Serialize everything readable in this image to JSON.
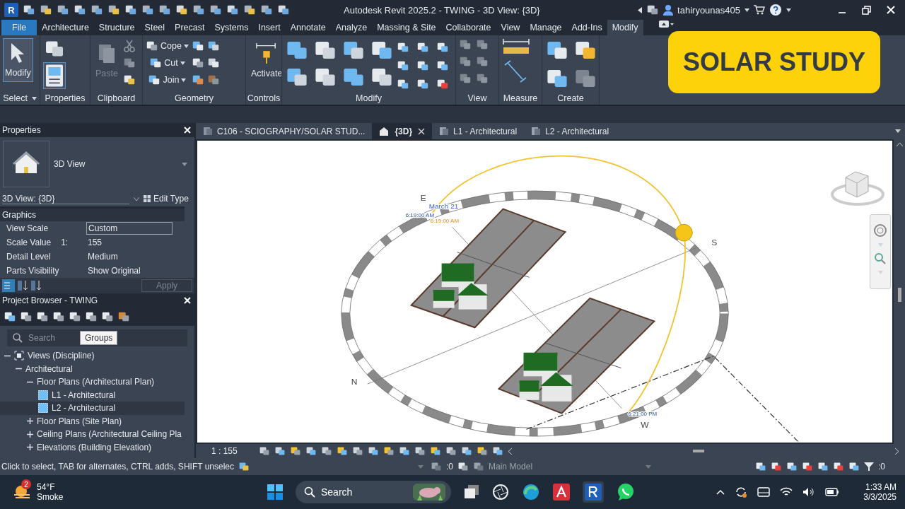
{
  "title_bar": {
    "logo": "R",
    "title": "Autodesk Revit 2025.2 - TWING - 3D View: {3D}",
    "user": "tahiryounas405"
  },
  "ribbon_tabs": [
    {
      "label": "File",
      "kind": "file",
      "selected": false
    },
    {
      "label": "Architecture",
      "kind": "tab",
      "selected": false
    },
    {
      "label": "Structure",
      "kind": "tab",
      "selected": false
    },
    {
      "label": "Steel",
      "kind": "tab",
      "selected": false
    },
    {
      "label": "Precast",
      "kind": "tab",
      "selected": false
    },
    {
      "label": "Systems",
      "kind": "tab",
      "selected": false
    },
    {
      "label": "Insert",
      "kind": "tab",
      "selected": false
    },
    {
      "label": "Annotate",
      "kind": "tab",
      "selected": false
    },
    {
      "label": "Analyze",
      "kind": "tab",
      "selected": false
    },
    {
      "label": "Massing & Site",
      "kind": "tab",
      "selected": false
    },
    {
      "label": "Collaborate",
      "kind": "tab",
      "selected": false
    },
    {
      "label": "View",
      "kind": "tab",
      "selected": false
    },
    {
      "label": "Manage",
      "kind": "tab",
      "selected": false
    },
    {
      "label": "Add-Ins",
      "kind": "tab",
      "selected": false
    },
    {
      "label": "Modify",
      "kind": "tab",
      "selected": true
    }
  ],
  "ribbon_panels": [
    {
      "title": "Select",
      "kind": "select",
      "tools": [
        {
          "label": "Modify",
          "selected": true
        }
      ]
    },
    {
      "title": "Properties",
      "kind": "properties"
    },
    {
      "title": "Clipboard",
      "kind": "clipboard",
      "tools": [
        {
          "label": "Paste",
          "disabled": true
        }
      ]
    },
    {
      "title": "Geometry",
      "kind": "geometry",
      "tools": [
        {
          "label": "Cope"
        },
        {
          "label": "Cut"
        },
        {
          "label": "Join"
        }
      ]
    },
    {
      "title": "Controls",
      "kind": "controls",
      "tools": [
        {
          "label": "Activate"
        }
      ]
    },
    {
      "title": "Modify",
      "kind": "modify"
    },
    {
      "title": "View",
      "kind": "view"
    },
    {
      "title": "Measure",
      "kind": "measure"
    },
    {
      "title": "Create",
      "kind": "create"
    }
  ],
  "banner": {
    "text": "SOLAR STUDY"
  },
  "properties": {
    "title": "Properties",
    "type_name": "3D View",
    "instance": "3D View: {3D}",
    "edit_type": "Edit Type",
    "group": "Graphics",
    "rows": [
      {
        "name": "View Scale",
        "value": "Custom",
        "kind": "field"
      },
      {
        "name": "Scale Value",
        "suffix": "1:",
        "value": "155",
        "kind": "text"
      },
      {
        "name": "Detail Level",
        "value": "Medium",
        "kind": "text"
      },
      {
        "name": "Parts Visibility",
        "value": "Show Original",
        "kind": "text"
      }
    ],
    "apply": "Apply"
  },
  "project_browser": {
    "title": "Project Browser - TWING",
    "search": {
      "placeholder": "Search"
    },
    "tooltip": "Groups",
    "tree": [
      {
        "label": "Views (Discipline)",
        "expanded": true,
        "selected": false,
        "children": [
          {
            "label": "Architectural",
            "expanded": true,
            "selected": false,
            "children": [
              {
                "label": "Floor Plans (Architectural Plan)",
                "expanded": true,
                "selected": false,
                "children": [
                  {
                    "label": "L1 - Architectural",
                    "selected": false
                  },
                  {
                    "label": "L2 - Architectural",
                    "selected": true
                  }
                ]
              },
              {
                "label": "Floor Plans (Site Plan)",
                "expanded": false,
                "selected": false
              },
              {
                "label": "Ceiling Plans (Architectural Ceiling Pla",
                "expanded": false,
                "selected": false
              },
              {
                "label": "Elevations (Building Elevation)",
                "expanded": false,
                "selected": false
              }
            ]
          }
        ]
      }
    ]
  },
  "view_tabs": [
    {
      "label": "C106 - SCIOGRAPHY/SOLAR STUD...",
      "kind": "sheet",
      "selected": false
    },
    {
      "label": "{3D}",
      "kind": "model",
      "selected": true
    },
    {
      "label": "L1 - Architectural",
      "kind": "plan",
      "selected": false
    },
    {
      "label": "L2 - Architectural",
      "kind": "plan",
      "selected": false
    }
  ],
  "viewport": {
    "labels": [
      {
        "text": "E",
        "kind": "compass"
      },
      {
        "text": "March 21",
        "kind": "date"
      },
      {
        "text": "6:19:00 AM",
        "kind": "time"
      },
      {
        "text": "6:19:00 AM",
        "kind": "sun_time"
      },
      {
        "text": "S",
        "kind": "compass"
      },
      {
        "text": "N",
        "kind": "compass"
      },
      {
        "text": "W",
        "kind": "compass"
      },
      {
        "text": "6:21:00 PM",
        "kind": "time"
      }
    ]
  },
  "view_control_bar": {
    "scale": "1 : 155"
  },
  "status_bar": {
    "hint": "Click to select, TAB for alternates, CTRL adds, SHIFT unselec",
    "workset": ":0",
    "model": "Main Model",
    "filter": ":0"
  },
  "taskbar": {
    "weather": {
      "badge": "2",
      "temp": "54°F",
      "condition": "Smoke"
    },
    "search": {
      "placeholder": "Search"
    },
    "time": "1:33 AM",
    "date": "3/3/2025"
  }
}
